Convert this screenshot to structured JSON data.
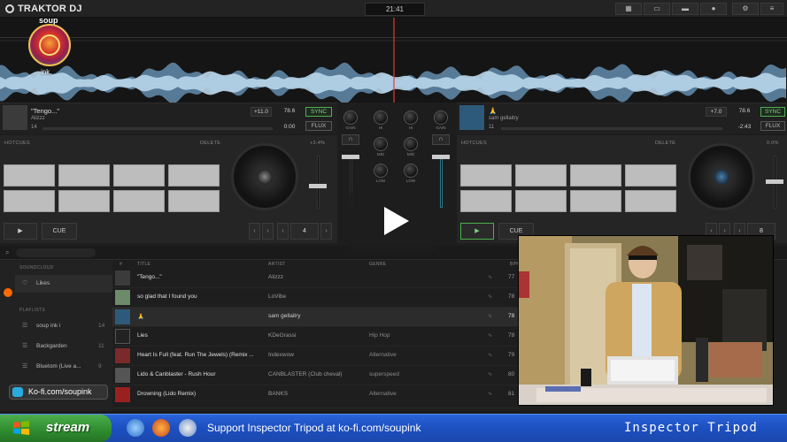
{
  "app": {
    "brand": "TRAKTOR DJ",
    "clock": "21:41"
  },
  "overlay": {
    "logo_top": "soup",
    "logo_bottom": "ink.",
    "kofi": "Ko-fi.com/soupink"
  },
  "deck_a": {
    "title": "\"Tengo...\"",
    "artist": "Alizzz",
    "key_num": "14",
    "tempo_adj": "+11.0",
    "bpm": "78.6",
    "time": "0:00",
    "sync": "SYNC",
    "flux": "FLUX",
    "hotcues_label": "HOTCUES",
    "delete_label": "DELETE",
    "pitch_pct": "+3.4%",
    "play": "▶",
    "cue": "CUE",
    "loop_size": "4"
  },
  "deck_b": {
    "title": "🙏",
    "artist": "sam gellaitry",
    "key_num": "11",
    "tempo_adj": "+7.0",
    "bpm": "78.6",
    "time": "-2:43",
    "sync": "SYNC",
    "flux": "FLUX",
    "hotcues_label": "HOTCUES",
    "delete_label": "DELETE",
    "pitch_pct": "0.0%",
    "play": "▶",
    "cue": "CUE",
    "loop_size": "8"
  },
  "mixer": {
    "knob_labels": [
      "GAIN",
      "HI",
      "HI",
      "GAIN",
      "MID",
      "MID",
      "LOW",
      "LOW"
    ]
  },
  "browser": {
    "sidebar": {
      "section1": "SOUNDCLOUD",
      "likes": "Likes",
      "section2": "PLAYLISTS",
      "playlists": [
        {
          "name": "soup ink i",
          "count": "14"
        },
        {
          "name": "Backgarden",
          "count": "11"
        },
        {
          "name": "Bluetom (Live a...",
          "count": "9"
        }
      ]
    },
    "columns": {
      "num": "#",
      "title": "TITLE",
      "artist": "ARTIST",
      "genre": "GENRE",
      "bpm": "BPM"
    },
    "rows": [
      {
        "title": "\"Tengo...\"",
        "artist": "Alizzz",
        "genre": "",
        "bpm": "77"
      },
      {
        "title": "so glad that I found you",
        "artist": "LoVibe",
        "genre": "",
        "bpm": "78"
      },
      {
        "title": "🙏",
        "artist": "sam gellaitry",
        "genre": "",
        "bpm": "78"
      },
      {
        "title": "Lies",
        "artist": "KDeGrassi",
        "genre": "Hip Hop",
        "bpm": "78"
      },
      {
        "title": "Heart Is Full (feat. Run The Jewels) (Remix ...",
        "artist": "Indexwow",
        "genre": "Alternative",
        "bpm": "79"
      },
      {
        "title": "Lido & Canblaster - Rush Hour",
        "artist": "CANBLASTER (Club cheval)",
        "genre": "superspeed",
        "bpm": "80"
      },
      {
        "title": "Drowning (Lido Remix)",
        "artist": "BANKS",
        "genre": "Alternative",
        "bpm": "81"
      }
    ]
  },
  "taskbar": {
    "start": "stream",
    "support": "Support Inspector Tripod at ko-fi.com/soupink",
    "channel": "Inspector Tripod"
  },
  "colors": {
    "accent_green": "#4caf50",
    "waveform": "#8fb9d9",
    "taskbar": "#2a63d8"
  }
}
